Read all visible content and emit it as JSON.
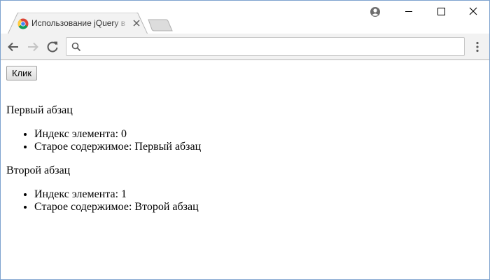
{
  "browser": {
    "tab_title": "Использование jQuery в",
    "address_value": "",
    "colors": {
      "accent_blue": "#4285f4",
      "tab_bg": "#f2f2f2",
      "toolbar_bg": "#f2f2f2"
    },
    "icons": [
      "chrome-favicon",
      "close-icon",
      "new-tab",
      "profile-icon",
      "minimize-icon",
      "maximize-icon",
      "window-close-icon",
      "back-arrow-icon",
      "forward-arrow-icon",
      "reload-icon",
      "search-icon",
      "menu-dots-icon"
    ]
  },
  "page": {
    "button_label": "Клик",
    "blocks": [
      {
        "paragraph": "Первый абзац",
        "items": [
          "Индекс элемента: 0",
          "Старое содержимое: Первый абзац"
        ]
      },
      {
        "paragraph": "Второй абзац",
        "items": [
          "Индекс элемента: 1",
          "Старое содержимое: Второй абзац"
        ]
      }
    ]
  }
}
